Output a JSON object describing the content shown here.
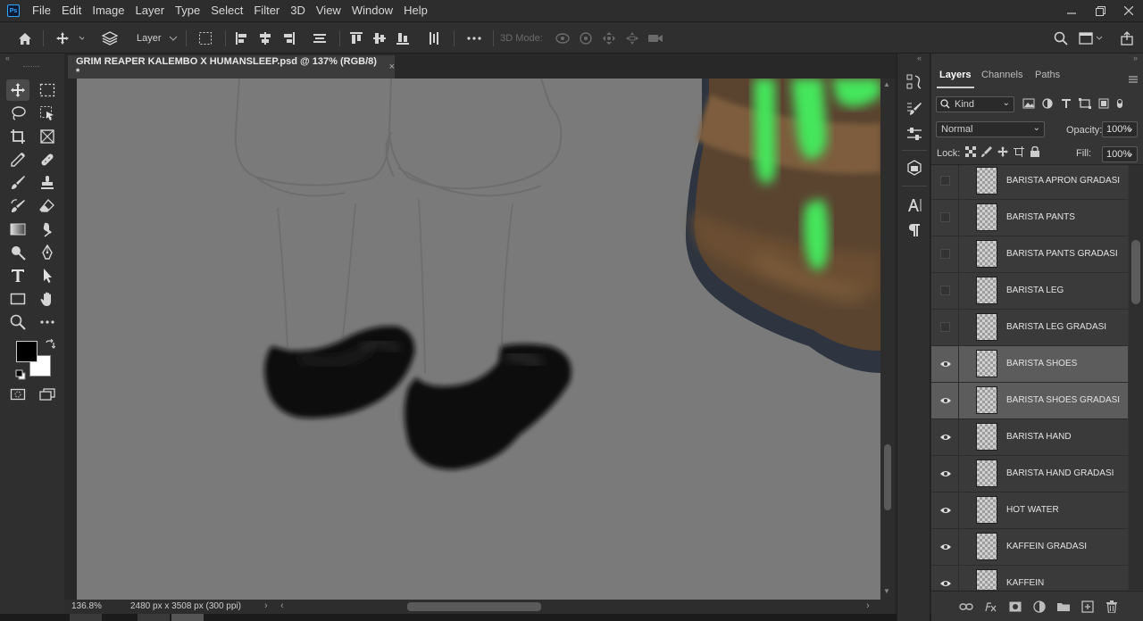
{
  "app": {
    "logo_text": "Ps"
  },
  "menu": [
    "File",
    "Edit",
    "Image",
    "Layer",
    "Type",
    "Select",
    "Filter",
    "3D",
    "View",
    "Window",
    "Help"
  ],
  "window_controls": [
    "minimize-icon",
    "restore-icon",
    "close-icon"
  ],
  "options_bar": {
    "auto_select_target": "Layer",
    "mode_3d_label": "3D Mode:"
  },
  "document": {
    "tab_title": "GRIM REAPER KALEMBO X HUMANSLEEP.psd @ 137% (RGB/8) *",
    "close_glyph": "×"
  },
  "status": {
    "zoom": "136.8%",
    "doc_size": "2480 px x 3508 px (300 ppi)"
  },
  "colors": {
    "foreground": "#000000",
    "background": "#ffffff",
    "canvas_gray": "#7a7a7a",
    "accent_green": "#44e65c"
  },
  "layers_panel": {
    "tabs": [
      "Layers",
      "Channels",
      "Paths"
    ],
    "kind_filter": "Kind",
    "blend_mode": "Normal",
    "opacity_label": "Opacity:",
    "opacity_value": "100%",
    "lock_label": "Lock:",
    "fill_label": "Fill:",
    "fill_value": "100%",
    "layers": [
      {
        "name": "BARISTA APRON GRADASI",
        "visible": false,
        "selected": false
      },
      {
        "name": "BARISTA PANTS",
        "visible": false,
        "selected": false
      },
      {
        "name": "BARISTA PANTS GRADASI",
        "visible": false,
        "selected": false
      },
      {
        "name": "BARISTA LEG",
        "visible": false,
        "selected": false
      },
      {
        "name": "BARISTA LEG GRADASI",
        "visible": false,
        "selected": false
      },
      {
        "name": "BARISTA SHOES",
        "visible": true,
        "selected": true
      },
      {
        "name": "BARISTA SHOES GRADASI",
        "visible": true,
        "selected": true
      },
      {
        "name": "BARISTA HAND",
        "visible": true,
        "selected": false
      },
      {
        "name": "BARISTA HAND GRADASI",
        "visible": true,
        "selected": false
      },
      {
        "name": "HOT WATER",
        "visible": true,
        "selected": false
      },
      {
        "name": "KAFFEIN GRADASI",
        "visible": true,
        "selected": false
      },
      {
        "name": "KAFFEIN",
        "visible": true,
        "selected": false
      }
    ]
  }
}
